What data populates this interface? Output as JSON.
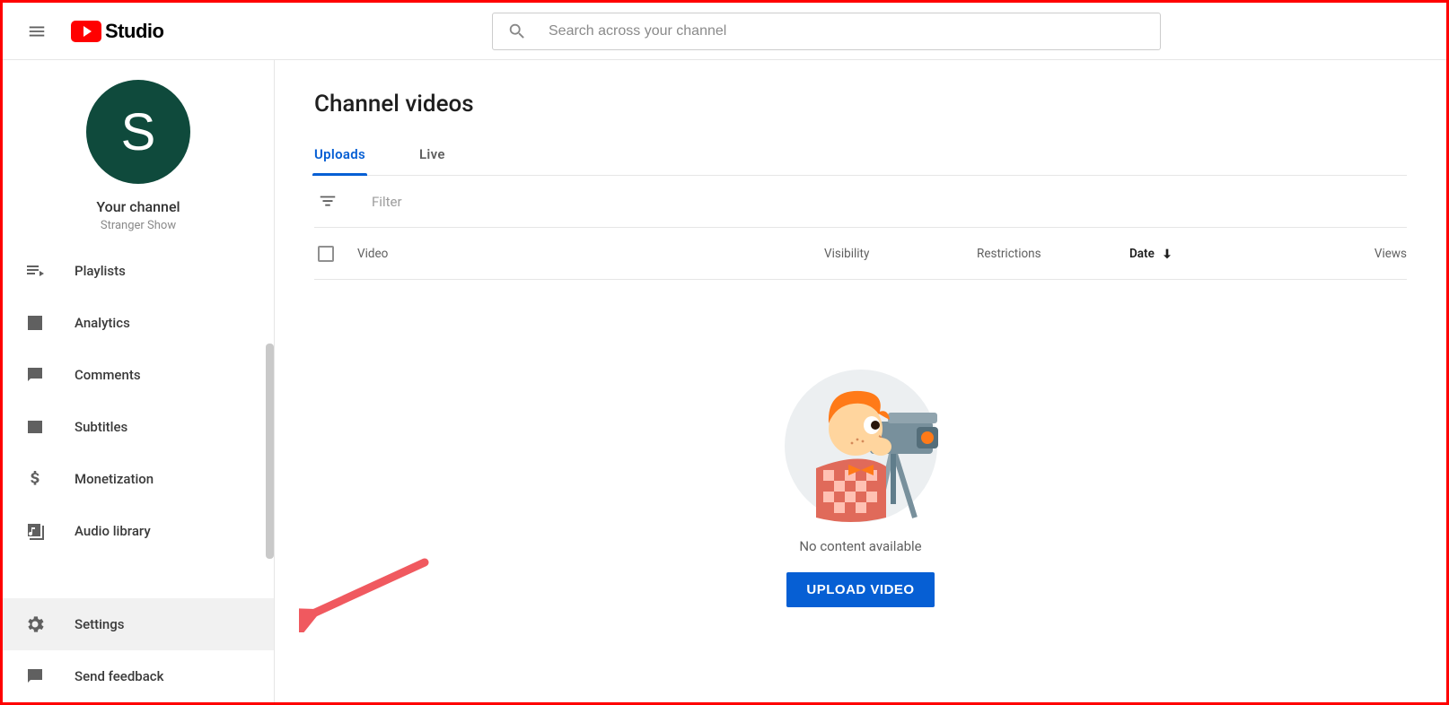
{
  "header": {
    "logo_text": "Studio",
    "search_placeholder": "Search across your channel"
  },
  "sidebar": {
    "avatar_letter": "S",
    "your_channel_label": "Your channel",
    "channel_name": "Stranger Show",
    "items": [
      {
        "label": "Playlists"
      },
      {
        "label": "Analytics"
      },
      {
        "label": "Comments"
      },
      {
        "label": "Subtitles"
      },
      {
        "label": "Monetization"
      },
      {
        "label": "Audio library"
      }
    ],
    "footer_items": [
      {
        "label": "Settings"
      },
      {
        "label": "Send feedback"
      }
    ]
  },
  "main": {
    "page_title": "Channel videos",
    "tabs": [
      {
        "label": "Uploads",
        "active": true
      },
      {
        "label": "Live",
        "active": false
      }
    ],
    "filter_placeholder": "Filter",
    "table": {
      "columns": {
        "video": "Video",
        "visibility": "Visibility",
        "restrictions": "Restrictions",
        "date": "Date",
        "views": "Views"
      },
      "sort_column": "date",
      "sort_dir": "desc"
    },
    "empty_state": {
      "message": "No content available",
      "button_label": "UPLOAD VIDEO"
    }
  }
}
